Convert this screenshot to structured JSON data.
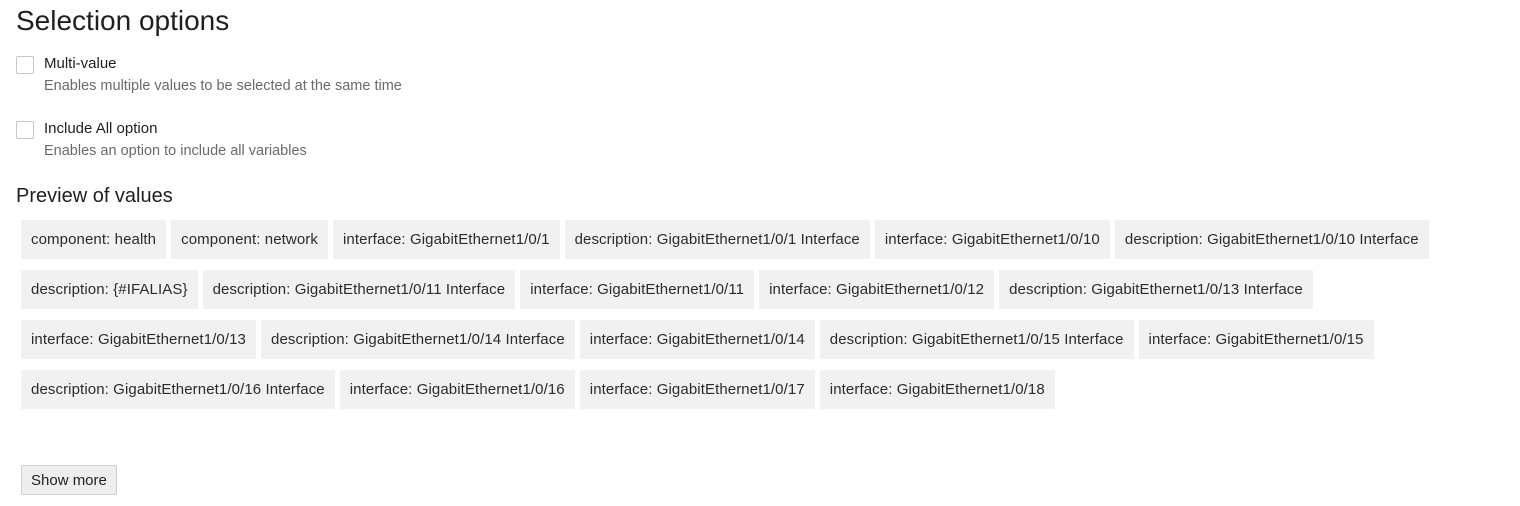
{
  "section": {
    "title": "Selection options"
  },
  "options": {
    "multi_value": {
      "label": "Multi-value",
      "description": "Enables multiple values to be selected at the same time",
      "checked": false
    },
    "include_all": {
      "label": "Include All option",
      "description": "Enables an option to include all variables",
      "checked": false
    }
  },
  "preview": {
    "title": "Preview of values",
    "values": [
      "component: health",
      "component: network",
      "interface: GigabitEthernet1/0/1",
      "description: GigabitEthernet1/0/1 Interface",
      "interface: GigabitEthernet1/0/10",
      "description: GigabitEthernet1/0/10 Interface",
      "description: {#IFALIAS}",
      "description: GigabitEthernet1/0/11 Interface",
      "interface: GigabitEthernet1/0/11",
      "interface: GigabitEthernet1/0/12",
      "description: GigabitEthernet1/0/13 Interface",
      "interface: GigabitEthernet1/0/13",
      "description: GigabitEthernet1/0/14 Interface",
      "interface: GigabitEthernet1/0/14",
      "description: GigabitEthernet1/0/15 Interface",
      "interface: GigabitEthernet1/0/15",
      "description: GigabitEthernet1/0/16 Interface",
      "interface: GigabitEthernet1/0/16",
      "interface: GigabitEthernet1/0/17",
      "interface: GigabitEthernet1/0/18"
    ],
    "show_more_label": "Show more"
  }
}
